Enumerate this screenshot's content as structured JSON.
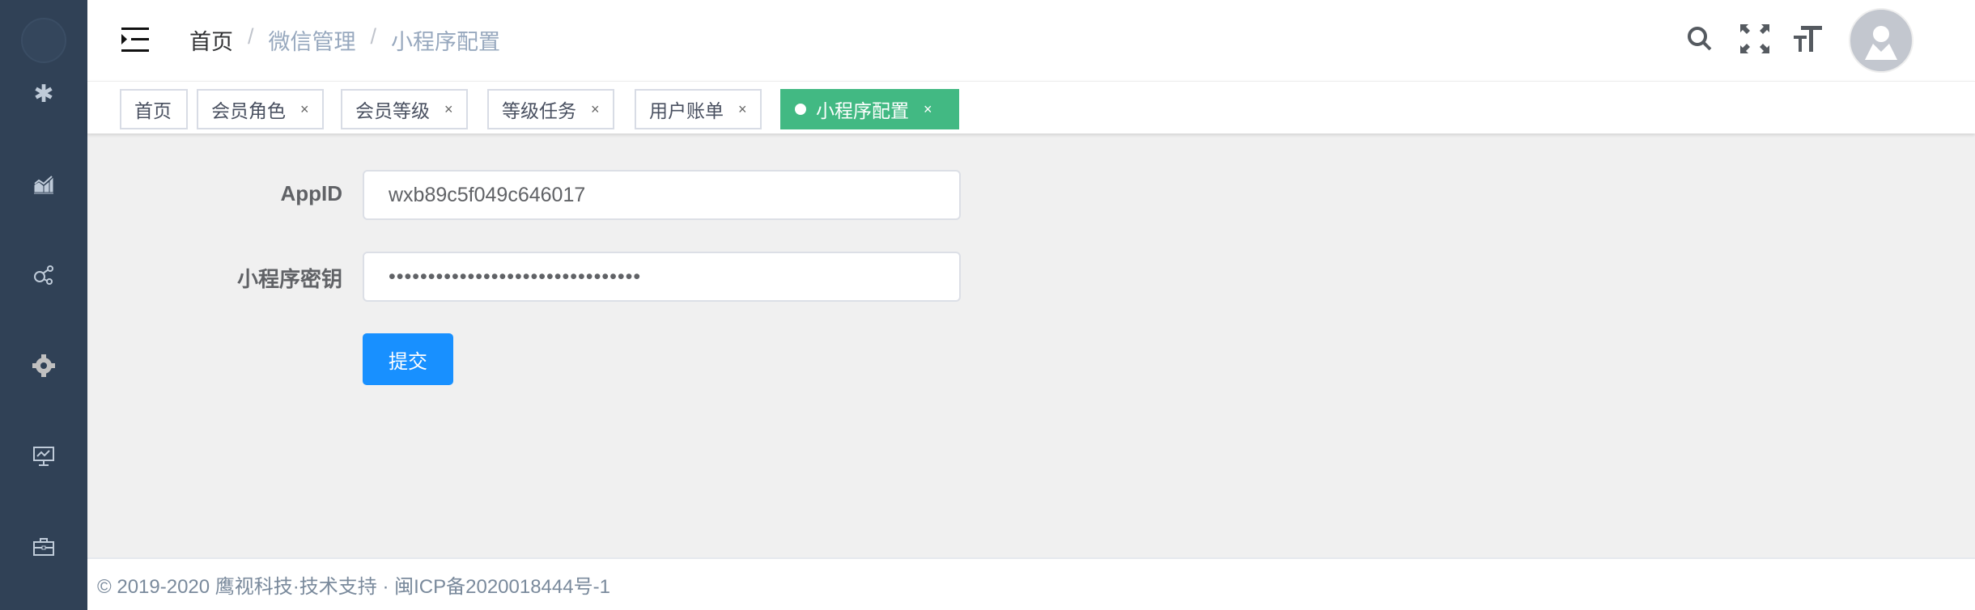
{
  "sidebar": {
    "icons": [
      "gear-icon",
      "chart-growth-icon",
      "finance-network-icon",
      "cog-icon",
      "monitor-chart-icon",
      "briefcase-icon"
    ]
  },
  "header": {
    "breadcrumb": [
      "首页",
      "微信管理",
      "小程序配置"
    ],
    "separator": "/"
  },
  "tags": [
    {
      "label": "首页",
      "closable": false
    },
    {
      "label": "会员角色",
      "closable": true
    },
    {
      "label": "会员等级",
      "closable": true
    },
    {
      "label": "等级任务",
      "closable": true
    },
    {
      "label": "用户账单",
      "closable": true
    },
    {
      "label": "小程序配置",
      "closable": true,
      "active": true
    }
  ],
  "close_glyph": "×",
  "form": {
    "appid_label": "AppID",
    "appid_value": "wxb89c5f049c646017",
    "secret_label": "小程序密钥",
    "secret_masked": "••••••••••••••••••••••••••••••••",
    "submit": "提交"
  },
  "footer": {
    "text": "© 2019-2020 鹰视科技·技术支持 · 闽ICP备2020018444号-1"
  },
  "colors": {
    "sidebar": "#304156",
    "active_tag": "#42b983",
    "primary": "#1890ff"
  }
}
